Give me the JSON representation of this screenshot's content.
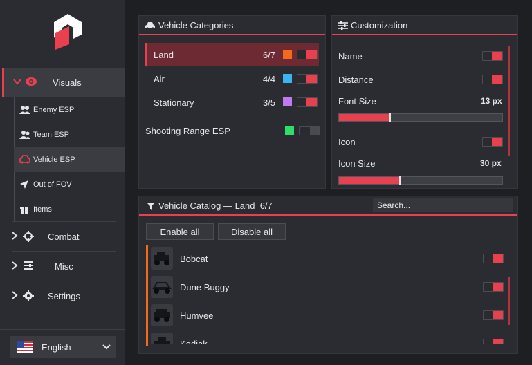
{
  "sidebar": {
    "main_items": [
      {
        "label": "Visuals",
        "icon": "eye-icon",
        "expanded": true
      },
      {
        "label": "Combat",
        "icon": "crosshair-icon"
      },
      {
        "label": "Misc",
        "icon": "sliders-icon"
      },
      {
        "label": "Settings",
        "icon": "gear-icon"
      }
    ],
    "sub_items": [
      {
        "label": "Enemy ESP",
        "icon": "users-icon"
      },
      {
        "label": "Team ESP",
        "icon": "user-group-icon"
      },
      {
        "label": "Vehicle ESP",
        "icon": "car-icon",
        "active": true
      },
      {
        "label": "Out of FOV",
        "icon": "location-arrow-icon"
      },
      {
        "label": "Items",
        "icon": "box-icon"
      }
    ],
    "language": {
      "label": "English",
      "flag": "us-flag-icon"
    }
  },
  "categories": {
    "title": "Vehicle Categories",
    "items": [
      {
        "label": "Land",
        "count": "6/7",
        "color": "#f26a1b",
        "enabled": true,
        "selected": true
      },
      {
        "label": "Air",
        "count": "4/4",
        "color": "#3cb4f0",
        "enabled": true
      },
      {
        "label": "Stationary",
        "count": "3/5",
        "color": "#c07af0",
        "enabled": true
      }
    ],
    "shooting_range": {
      "label": "Shooting Range ESP",
      "color": "#2ee06a",
      "enabled": false
    }
  },
  "customization": {
    "title": "Customization",
    "name_label": "Name",
    "distance_label": "Distance",
    "font_size_label": "Font Size",
    "font_size_value": "13 px",
    "font_size_fraction": 0.31,
    "icon_label": "Icon",
    "icon_size_label": "Icon Size",
    "icon_size_value": "30 px",
    "icon_size_fraction": 0.37
  },
  "catalog": {
    "title": "Vehicle Catalog — Land  6/7",
    "search_placeholder": "Search...",
    "enable_all": "Enable all",
    "disable_all": "Disable all",
    "vehicles": [
      {
        "name": "Bobcat",
        "enabled": true
      },
      {
        "name": "Dune Buggy",
        "enabled": true
      },
      {
        "name": "Humvee",
        "enabled": true
      },
      {
        "name": "Kodiak",
        "enabled": true
      }
    ]
  },
  "colors": {
    "accent": "#e8404f",
    "panel": "#2b2c31",
    "background": "#1e1f23"
  }
}
